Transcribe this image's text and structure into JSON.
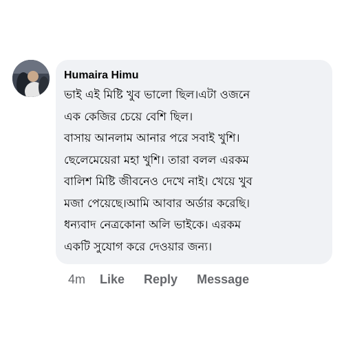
{
  "comment": {
    "author": "Humaira Himu",
    "avatar_icon": "user-avatar",
    "lines": [
      "ভাই এই মিষ্টি  খুব ভালো ছিল।এটা ওজনে",
      "এক কেজির চেয়ে বেশি ছিল।",
      "বাসায় আনলাম আনার পরে সবাই খুশি।",
      "ছেলেমেয়েরা মহা খুশি। তারা বলল এরকম",
      "বালিশ মিষ্টি জীবনেও দেখে নাই। খেয়ে খুব",
      "মজা পেয়েছে।আমি আবার অর্ডার করেছি।",
      "ধন্যবাদ নেত্রকোনা অলি ভাইকে। এরকম",
      "একটি সুযোগ করে দেওয়ার জন্য।"
    ],
    "bubble_color": "#f0f2f5"
  },
  "actions": {
    "time": "4m",
    "like": "Like",
    "reply": "Reply",
    "message": "Message"
  }
}
